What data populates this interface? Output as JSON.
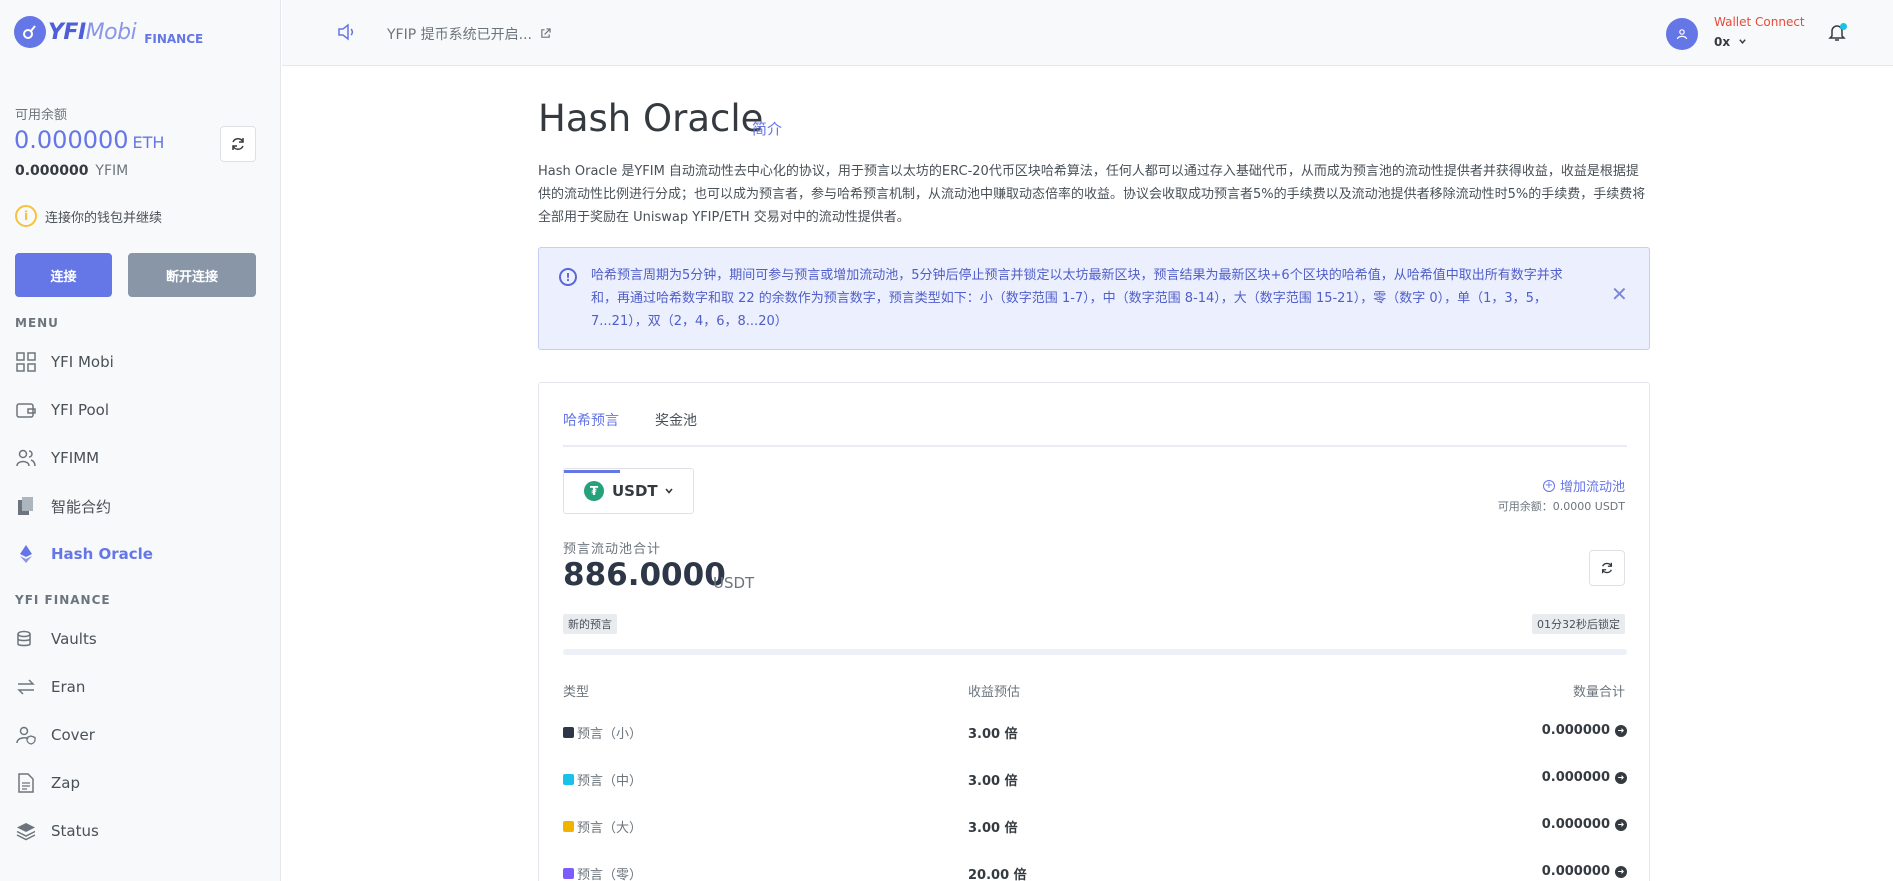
{
  "brand": {
    "name_bold": "YFI",
    "name_thin": "Mobi",
    "sub": "FINANCE"
  },
  "balance": {
    "label": "可用余额",
    "eth_value": "0.000000",
    "eth_unit": "ETH",
    "yfim_value": "0.000000",
    "yfim_unit": "YFIM",
    "notice": "连接你的钱包并继续"
  },
  "buttons": {
    "connect": "连接",
    "disconnect": "断开连接"
  },
  "menu": {
    "title": "MENU",
    "items": [
      {
        "label": "YFI Mobi",
        "icon": "grid-icon"
      },
      {
        "label": "YFI Pool",
        "icon": "wallet-icon"
      },
      {
        "label": "YFIMM",
        "icon": "users-icon"
      },
      {
        "label": "智能合约",
        "icon": "documents-icon"
      },
      {
        "label": "Hash Oracle",
        "icon": "ethereum-icon",
        "active": true
      }
    ]
  },
  "finance": {
    "title": "YFI FINANCE",
    "items": [
      {
        "label": "Vaults",
        "icon": "coins-icon"
      },
      {
        "label": "Eran",
        "icon": "swap-icon"
      },
      {
        "label": "Cover",
        "icon": "user-shield-icon"
      },
      {
        "label": "Zap",
        "icon": "file-icon"
      },
      {
        "label": "Status",
        "icon": "layers-icon"
      }
    ]
  },
  "topbar": {
    "announcement": "YFIP 提币系统已开启...",
    "wallet_label": "Wallet Connect",
    "wallet_address": "0x"
  },
  "page": {
    "title": "Hash Oracle",
    "subtitle": "简介",
    "description": "Hash Oracle 是YFIM 自动流动性去中心化的协议，用于预言以太坊的ERC-20代币区块哈希算法，任何人都可以通过存入基础代币，从而成为预言池的流动性提供者并获得收益，收益是根据提供的流动性比例进行分成；也可以成为预言者，参与哈希预言机制，从流动池中赚取动态倍率的收益。协议会收取成功预言者5%的手续费以及流动池提供者移除流动性时5%的手续费，手续费将全部用于奖励在 Uniswap YFIP/ETH 交易对中的流动性提供者。",
    "alert": "哈希预言周期为5分钟，期间可参与预言或增加流动池，5分钟后停止预言并锁定以太坊最新区块，预言结果为最新区块+6个区块的哈希值，从哈希值中取出所有数字并求和，再通过哈希数字和取 22 的余数作为预言数字，预言类型如下：小（数字范围 1-7），中（数字范围 8-14），大（数字范围 15-21），零（数字 0），单（1，3，5，7...21），双（2，4，6，8...20）"
  },
  "card": {
    "tabs": [
      "哈希预言",
      "奖金池"
    ],
    "token": "USDT",
    "add_pool": "增加流动池",
    "available": "可用余额：0.0000 USDT",
    "pool_label": "预言流动池合计",
    "pool_value": "886.0000",
    "pool_unit": "USDT",
    "badge_new": "新的预言",
    "badge_lock": "01分32秒后锁定",
    "progress": 0,
    "headers": {
      "type": "类型",
      "odds": "收益预估",
      "qty": "数量合计"
    },
    "rows": [
      {
        "type": "预言（小）",
        "color": "#2d3748",
        "odds": "3.00 倍",
        "qty": "0.000000"
      },
      {
        "type": "预言（中）",
        "color": "#17c1e8",
        "odds": "3.00 倍",
        "qty": "0.000000"
      },
      {
        "type": "预言（大）",
        "color": "#f0b400",
        "odds": "3.00 倍",
        "qty": "0.000000"
      },
      {
        "type": "预言（零）",
        "color": "#7c5cfa",
        "odds": "20.00 倍",
        "qty": "0.000000"
      }
    ]
  }
}
